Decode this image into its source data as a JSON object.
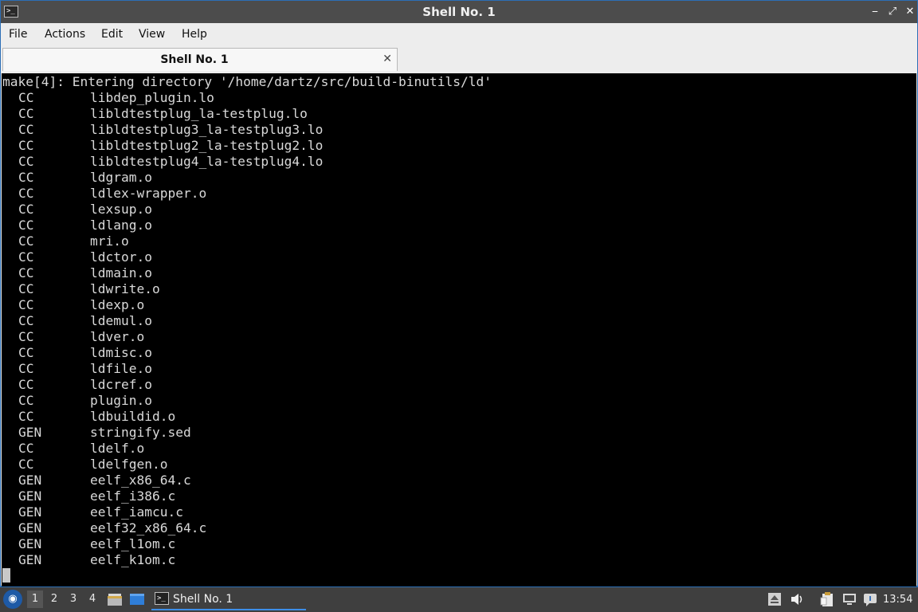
{
  "window": {
    "title": "Shell No. 1",
    "controls": {
      "minimize": "⎯",
      "maximize": "⤢",
      "close": "✕"
    },
    "app_icon": "terminal-icon"
  },
  "menubar": {
    "items": [
      "File",
      "Actions",
      "Edit",
      "View",
      "Help"
    ]
  },
  "tab": {
    "label": "Shell No. 1",
    "close": "✕"
  },
  "terminal": {
    "header": "make[4]: Entering directory '/home/dartz/src/build-binutils/ld'",
    "lines": [
      {
        "action": "CC",
        "target": "libdep_plugin.lo"
      },
      {
        "action": "CC",
        "target": "libldtestplug_la-testplug.lo"
      },
      {
        "action": "CC",
        "target": "libldtestplug3_la-testplug3.lo"
      },
      {
        "action": "CC",
        "target": "libldtestplug2_la-testplug2.lo"
      },
      {
        "action": "CC",
        "target": "libldtestplug4_la-testplug4.lo"
      },
      {
        "action": "CC",
        "target": "ldgram.o"
      },
      {
        "action": "CC",
        "target": "ldlex-wrapper.o"
      },
      {
        "action": "CC",
        "target": "lexsup.o"
      },
      {
        "action": "CC",
        "target": "ldlang.o"
      },
      {
        "action": "CC",
        "target": "mri.o"
      },
      {
        "action": "CC",
        "target": "ldctor.o"
      },
      {
        "action": "CC",
        "target": "ldmain.o"
      },
      {
        "action": "CC",
        "target": "ldwrite.o"
      },
      {
        "action": "CC",
        "target": "ldexp.o"
      },
      {
        "action": "CC",
        "target": "ldemul.o"
      },
      {
        "action": "CC",
        "target": "ldver.o"
      },
      {
        "action": "CC",
        "target": "ldmisc.o"
      },
      {
        "action": "CC",
        "target": "ldfile.o"
      },
      {
        "action": "CC",
        "target": "ldcref.o"
      },
      {
        "action": "CC",
        "target": "plugin.o"
      },
      {
        "action": "CC",
        "target": "ldbuildid.o"
      },
      {
        "action": "GEN",
        "target": "stringify.sed"
      },
      {
        "action": "CC",
        "target": "ldelf.o"
      },
      {
        "action": "CC",
        "target": "ldelfgen.o"
      },
      {
        "action": "GEN",
        "target": "eelf_x86_64.c"
      },
      {
        "action": "GEN",
        "target": "eelf_i386.c"
      },
      {
        "action": "GEN",
        "target": "eelf_iamcu.c"
      },
      {
        "action": "GEN",
        "target": "eelf32_x86_64.c"
      },
      {
        "action": "GEN",
        "target": "eelf_l1om.c"
      },
      {
        "action": "GEN",
        "target": "eelf_k1om.c"
      }
    ]
  },
  "taskbar": {
    "desktops": [
      "1",
      "2",
      "3",
      "4"
    ],
    "active_desktop": "1",
    "task_label": "Shell No. 1",
    "clock": "13:54",
    "tray_icons": [
      "eject-icon",
      "volume-icon",
      "clipboard-icon",
      "network-icon",
      "chat-icon"
    ]
  },
  "colors": {
    "accent": "#2c6fb7",
    "titlebar": "#4c4c4c",
    "terminal_bg": "#000000",
    "terminal_fg": "#d9d9d9",
    "panel_bg": "#3f3f3f"
  }
}
